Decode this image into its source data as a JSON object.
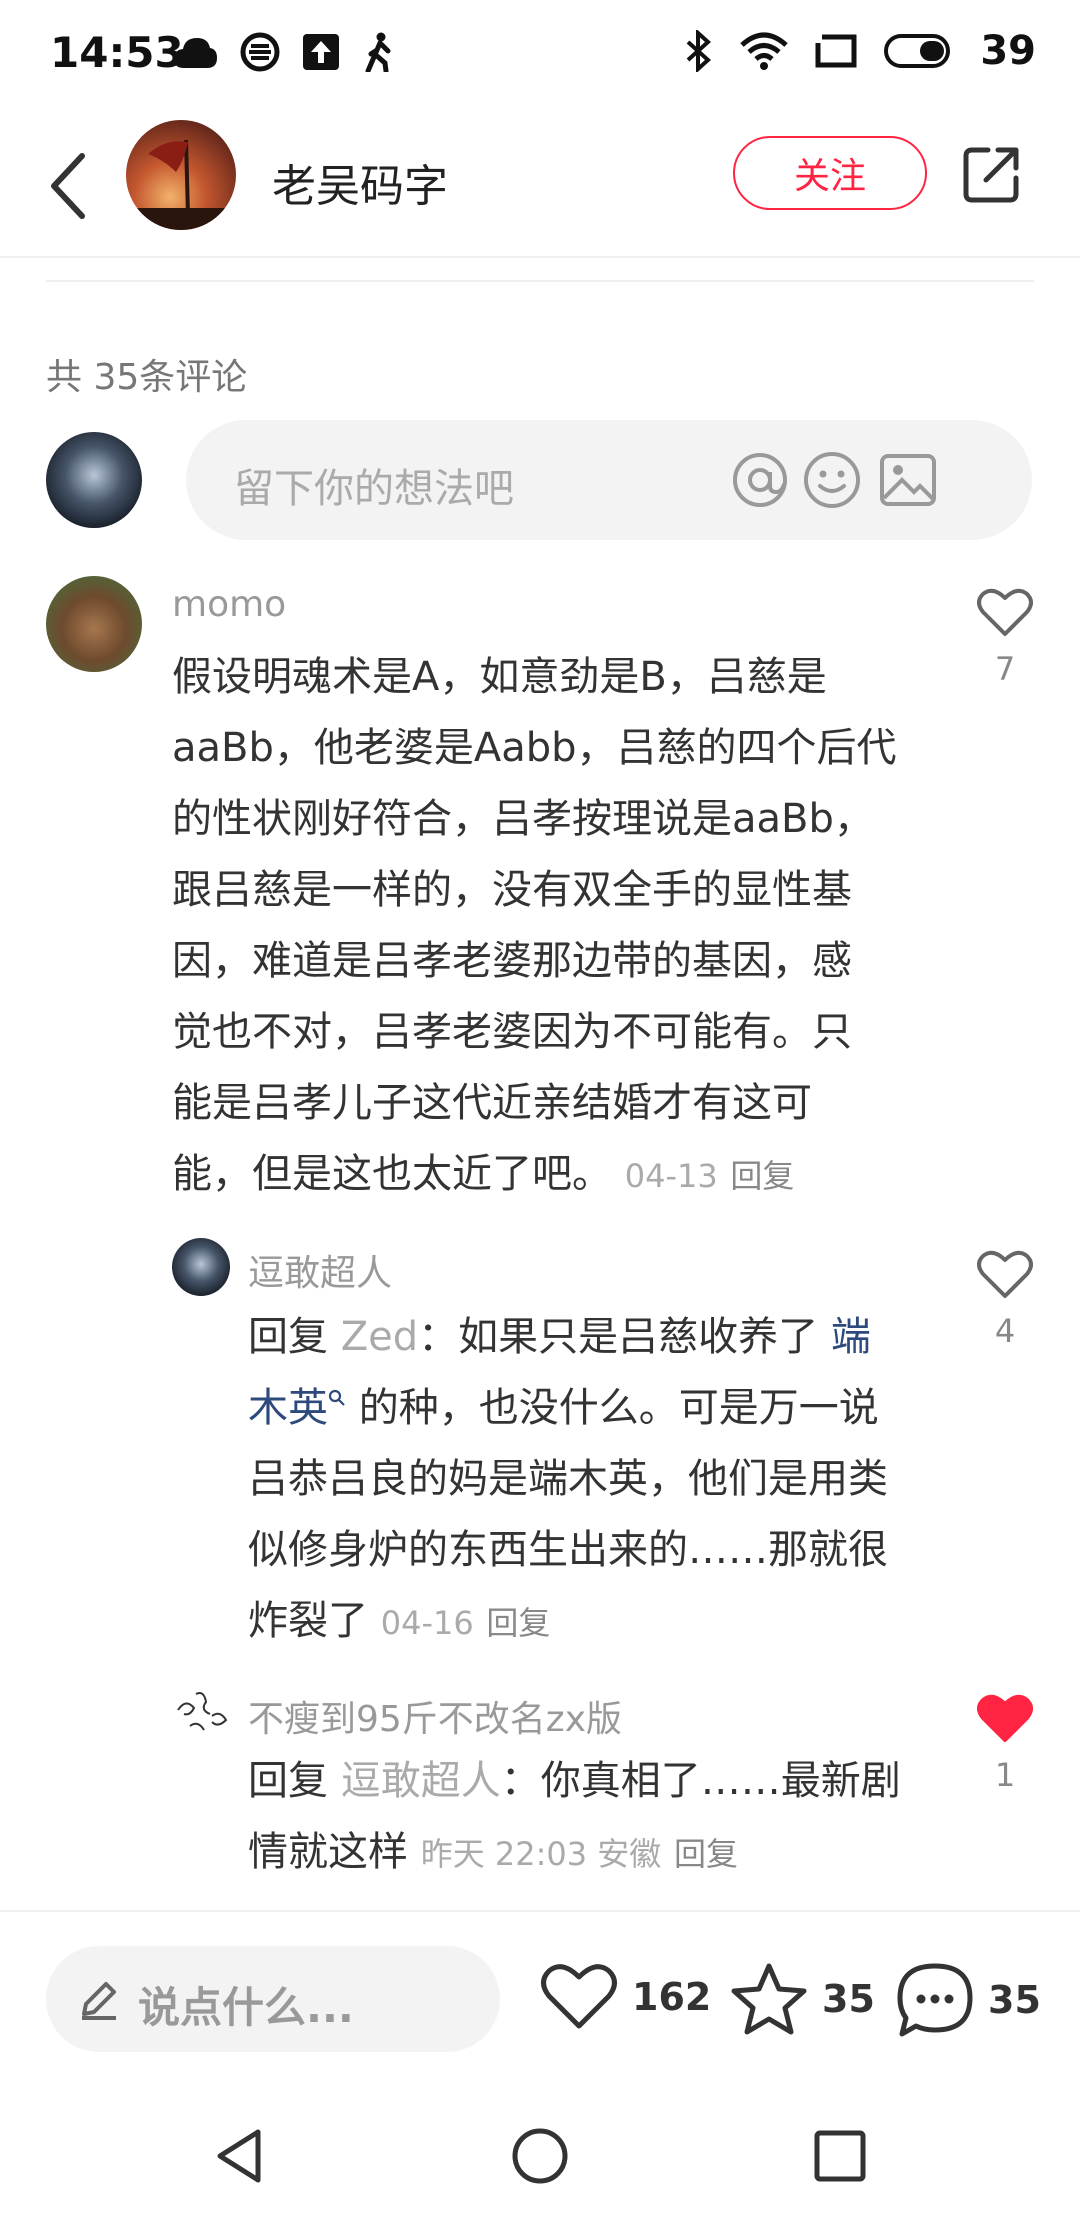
{
  "status_bar": {
    "time": "14:53",
    "battery": "39",
    "icons_left": [
      "cloud-icon",
      "signal-app-icon",
      "upload-icon",
      "walk-icon"
    ],
    "icons_right": [
      "bluetooth-icon",
      "wifi-icon",
      "screen-icon",
      "battery-icon"
    ]
  },
  "header": {
    "author_name": "老吴码字",
    "follow_label": "关注"
  },
  "comments_section": {
    "count_text": "共 35条评论",
    "input_placeholder": "留下你的想法吧"
  },
  "comments": [
    {
      "user": "momo",
      "lines": [
        "假设明魂术是A，如意劲是B，吕慈是",
        "aaBb，他老婆是Aabb，吕慈的四个后代",
        "的性状刚好符合，吕孝按理说是aaBb，",
        "跟吕慈是一样的，没有双全手的显性基",
        "因，难道是吕孝老婆那边带的基因，感",
        "觉也不对，吕孝老婆因为不可能有。只",
        "能是吕孝儿子这代近亲结婚才有这可"
      ],
      "last_line": "能，但是这也太近了吧。",
      "date": "04-13",
      "reply_label": "回复",
      "likes": "7",
      "liked": false
    },
    {
      "user": "逗敢超人",
      "reply_prefix": "回复",
      "reply_to": "Zed",
      "line1_text": "：如果只是吕慈收养了",
      "link_part1": "端",
      "link_part2": "木英",
      "line2_rest": "的种，也没什么。可是万一说",
      "lines": [
        "吕恭吕良的妈是端木英，他们是用类",
        "似修身炉的东西生出来的……那就很"
      ],
      "last_line": "炸裂了",
      "date": "04-16",
      "reply_label": "回复",
      "likes": "4",
      "liked": false
    },
    {
      "user": "不瘦到95斤不改名zx版",
      "reply_prefix": "回复",
      "reply_to": "逗敢超人",
      "line1_text": "：你真相了……最新剧",
      "last_line": "情就这样",
      "date": "昨天 22:03 安徽",
      "reply_label": "回复",
      "likes": "1",
      "liked": true
    }
  ],
  "bottom_bar": {
    "say_placeholder": "说点什么...",
    "likes": "162",
    "stars": "35",
    "comments": "35"
  },
  "colors": {
    "accent": "#ff2442",
    "link": "#2e4a7c"
  }
}
